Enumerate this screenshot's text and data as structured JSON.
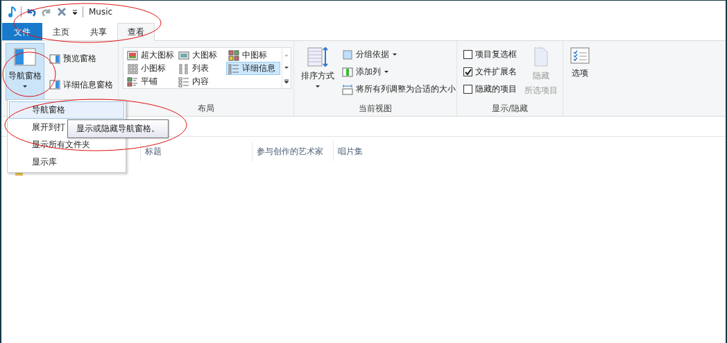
{
  "title_bar": {
    "title": "Music"
  },
  "tabs": [
    {
      "label": "文件",
      "kind": "file",
      "selected": false
    },
    {
      "label": "主页",
      "kind": "tab",
      "selected": false
    },
    {
      "label": "共享",
      "kind": "tab",
      "selected": false
    },
    {
      "label": "查看",
      "kind": "tab",
      "selected": true
    }
  ],
  "ribbon": {
    "panes": {
      "nav_pane": {
        "label": "导航窗格",
        "selected": true
      },
      "items": [
        "预览窗格",
        "详细信息窗格"
      ]
    },
    "layout": {
      "label": "布局",
      "options": [
        {
          "label": "超大图标",
          "selected": false
        },
        {
          "label": "大图标",
          "selected": false
        },
        {
          "label": "中图标",
          "selected": false
        },
        {
          "label": "小图标",
          "selected": false
        },
        {
          "label": "列表",
          "selected": false
        },
        {
          "label": "详细信息",
          "selected": true
        },
        {
          "label": "平铺",
          "selected": false
        },
        {
          "label": "内容",
          "selected": false
        }
      ]
    },
    "current_view": {
      "label": "当前视图",
      "sort": "排序方式",
      "items": [
        {
          "label": "分组依据",
          "dropdown": true
        },
        {
          "label": "添加列",
          "dropdown": true
        },
        {
          "label": "将所有列调整为合适的大小",
          "dropdown": false
        }
      ]
    },
    "show_hide": {
      "label": "显示/隐藏",
      "checkboxes": [
        {
          "label": "项目复选框",
          "checked": false
        },
        {
          "label": "文件扩展名",
          "checked": true
        },
        {
          "label": "隐藏的项目",
          "checked": false
        }
      ],
      "hide_selected": {
        "label": "隐藏",
        "sublabel": "所选项目",
        "disabled": true
      }
    },
    "options": {
      "label": "选项"
    }
  },
  "nav_menu": {
    "items": [
      {
        "label": "导航窗格",
        "selected": true
      },
      {
        "label": "展开到打",
        "selected": false
      },
      {
        "label": "显示所有文件夹",
        "selected": false
      },
      {
        "label": "显示库",
        "selected": false
      }
    ]
  },
  "tooltip": "显示或隐藏导航窗格。",
  "columns": [
    "标题",
    "参与创作的艺术家",
    "唱片集"
  ]
}
